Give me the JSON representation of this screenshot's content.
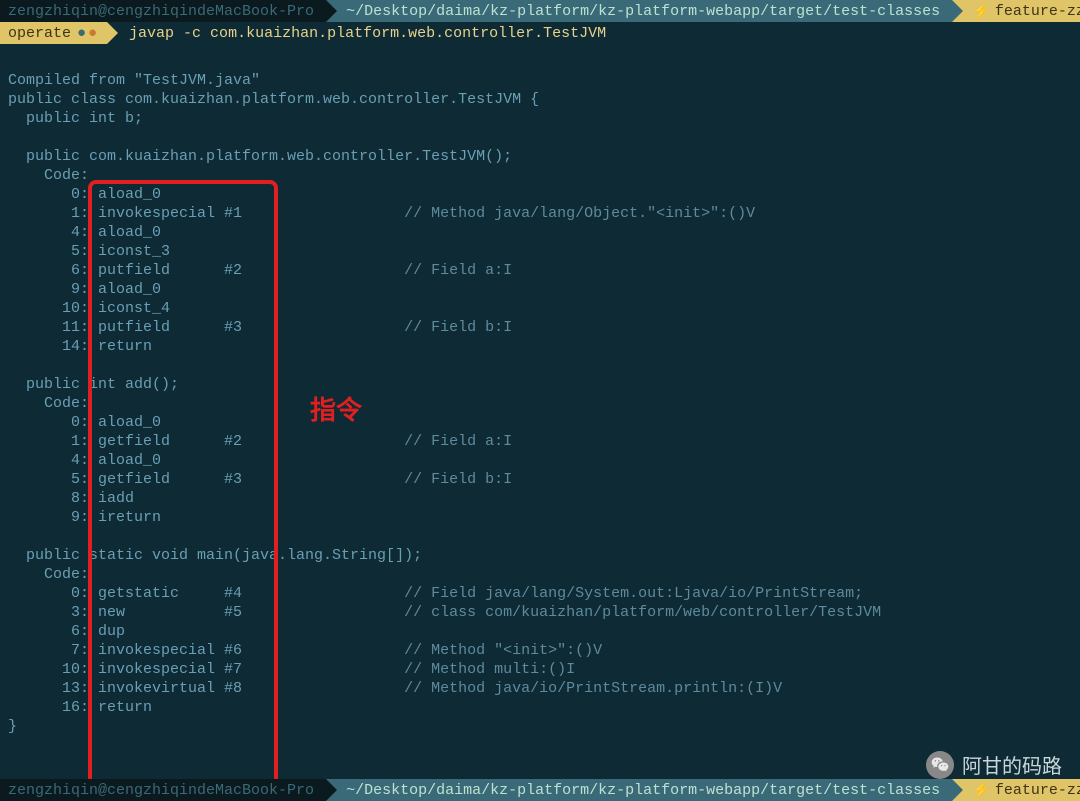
{
  "prompt_top": {
    "user": "zengzhiqin@cengzhiqindeMacBook-Pro",
    "path": "~/Desktop/daima/kz-platform/kz-platform-webapp/target/test-classes",
    "branch": "feature-zzq-"
  },
  "row2": {
    "operate": "operate",
    "command": "javap -c com.kuaizhan.platform.web.controller.TestJVM"
  },
  "prompt_bottom": {
    "user": "zengzhiqin@cengzhiqindeMacBook-Pro",
    "path": "~/Desktop/daima/kz-platform/kz-platform-webapp/target/test-classes",
    "branch": "feature-zzq-"
  },
  "annotation": "指令",
  "watermark": "阿甘的码路",
  "output": {
    "compiled_from": "Compiled from \"TestJVM.java\"",
    "class_decl": "public class com.kuaizhan.platform.web.controller.TestJVM {",
    "field_b": "  public int b;",
    "ctor_sig": "  public com.kuaizhan.platform.web.controller.TestJVM();",
    "code_label": "    Code:",
    "ctor": {
      "l0": "       0: aload_0",
      "l1": "       1: invokespecial #1",
      "c1": "                  // Method java/lang/Object.\"<init>\":()V",
      "l4": "       4: aload_0",
      "l5": "       5: iconst_3",
      "l6": "       6: putfield      #2",
      "c6": "                  // Field a:I",
      "l9": "       9: aload_0",
      "l10": "      10: iconst_4",
      "l11": "      11: putfield      #3",
      "c11": "                  // Field b:I",
      "l14": "      14: return"
    },
    "add_sig": "  public int add();",
    "add": {
      "l0": "       0: aload_0",
      "l1": "       1: getfield      #2",
      "c1": "                  // Field a:I",
      "l4": "       4: aload_0",
      "l5": "       5: getfield      #3",
      "c5": "                  // Field b:I",
      "l8": "       8: iadd",
      "l9": "       9: ireturn"
    },
    "main_sig": "  public static void main(java.lang.String[]);",
    "main": {
      "l0": "       0: getstatic     #4",
      "c0": "                  // Field java/lang/System.out:Ljava/io/PrintStream;",
      "l3": "       3: new           #5",
      "c3": "                  // class com/kuaizhan/platform/web/controller/TestJVM",
      "l6": "       6: dup",
      "l7": "       7: invokespecial #6",
      "c7": "                  // Method \"<init>\":()V",
      "l10": "      10: invokespecial #7",
      "c10": "                  // Method multi:()I",
      "l13": "      13: invokevirtual #8",
      "c13": "                  // Method java/io/PrintStream.println:(I)V",
      "l16": "      16: return"
    },
    "close": "}"
  }
}
